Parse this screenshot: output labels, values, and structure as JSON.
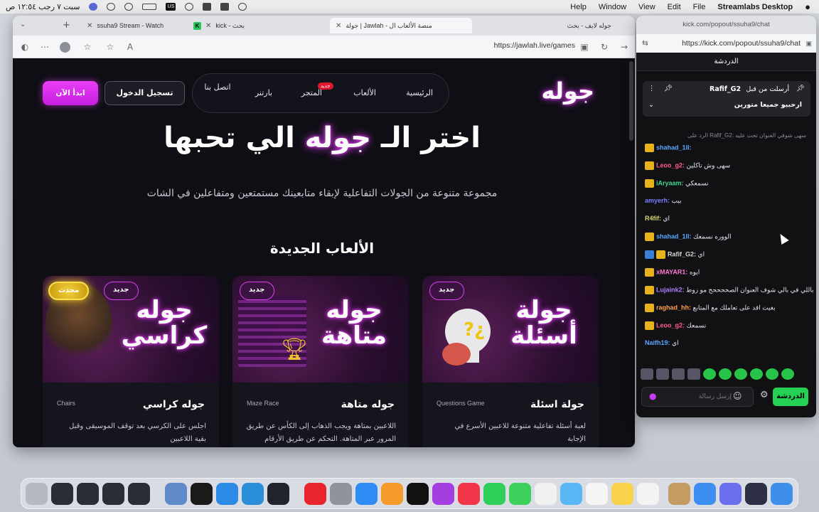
{
  "menubar": {
    "app_name": "Streamlabs Desktop",
    "menus": [
      "File",
      "Edit",
      "View",
      "Window",
      "Help"
    ],
    "clock": "سبت ٧ رجب ١٢:٥٤ ص"
  },
  "browser": {
    "tabs": [
      {
        "label": "جوله لايف - بحث"
      },
      {
        "label": "جولة | Jawlah - منصة الألعاب ال"
      },
      {
        "label": "kick - بحث"
      },
      {
        "label": "ssuha9 Stream - Watch"
      }
    ],
    "url": "https://jawlah.live/games"
  },
  "site": {
    "logo": "جوله",
    "nav": [
      "الرئيسية",
      "الألعاب",
      "المتجر",
      "بارتنر",
      "اتصل بنا"
    ],
    "nav_badge": "جديد",
    "login_label": "تسجيل الدخول",
    "start_label": "ابدأ الآن",
    "hero_pre": "اختر الـ",
    "hero_glow": "جوله",
    "hero_post": "الي تحبها",
    "subtitle": "مجموعة متنوعة من الجولات التفاعلية لإبقاء متابعينك مستمتعين ومتفاعلين في الشات",
    "section_title": "الألعاب الجديدة",
    "cards": [
      {
        "art_title": "جولة أسئلة",
        "badge": "جديد",
        "title": "جولة اسئلة",
        "tag": "Questions Game",
        "desc": "لعبة أسئلة تفاعلية متنوعة للاعبين الأسرع في الإجابة"
      },
      {
        "art_title": "جوله متاهة",
        "badge": "جديد",
        "title": "جوله متاهة",
        "tag": "Maze Race",
        "desc": "اللاعبين بمتاهة ويجب الذهاب إلى الكأس عن طريق المرور عبر المتاهة. التحكم عن طريق الأرقام"
      },
      {
        "art_title": "جوله كراسي",
        "badge": "جديد",
        "badge2": "محدث",
        "title": "جوله كراسي",
        "tag": "Chairs",
        "desc": "اجلس على الكرسي بعد توقف الموسيقى وقبل بقية اللاعبين"
      }
    ]
  },
  "chat": {
    "window_title": "kick.com/popout/ssuha9/chat",
    "url": "https://kick.com/popout/ssuha9/chat",
    "header": "الدردشة",
    "pinned_by": "أرسلت من قبل",
    "pinned_user": "Rafif_G2",
    "pinned_text": "ارحبيو جميعا متورين",
    "reply_hint": "الرد على Rafif_G2: سهى شوفي العنوان تحت عليه",
    "messages": [
      {
        "user": "shahad_1ll",
        "text": "",
        "color": "#57a6ff",
        "badge": "crown"
      },
      {
        "user": "Leoo_g2",
        "text": "سهى وش تاكلين",
        "color": "#ff5a8c",
        "badge": "crown"
      },
      {
        "user": "iAryaam",
        "text": "نسمعكي",
        "color": "#3fd98a",
        "badge": "crown"
      },
      {
        "user": "amyerh",
        "text": "بيب",
        "color": "#7a7dff",
        "badge": ""
      },
      {
        "user": "R4fif",
        "text": "اي",
        "color": "#d7d36c",
        "badge": ""
      },
      {
        "user": "shahad_1ll",
        "text": "الووره نسمعك",
        "color": "#57a6ff",
        "badge": "crown"
      },
      {
        "user": "Rafif_G2",
        "text": "اي",
        "color": "#d7d7d7",
        "badge": "both"
      },
      {
        "user": "xMAYAR1",
        "text": "ايوه",
        "color": "#ff77d2",
        "badge": "crown"
      },
      {
        "user": "Lujaink2",
        "text": "باللي في بالي شوف العنوان الصححححح مو زوط",
        "color": "#b47aff",
        "badge": "crown"
      },
      {
        "user": "raghad_hh",
        "text": "بغيت اقد على تعاملك مع المتابع",
        "color": "#ff9e4d",
        "badge": "crown"
      },
      {
        "user": "Leoo_g2",
        "text": "نسمعك",
        "color": "#ff5a8c",
        "badge": "crown"
      },
      {
        "user": "Naifh19",
        "text": "اي",
        "color": "#57a6ff",
        "badge": ""
      }
    ],
    "input_placeholder": "إرسل رسالة",
    "send_label": "الدردشة"
  }
}
